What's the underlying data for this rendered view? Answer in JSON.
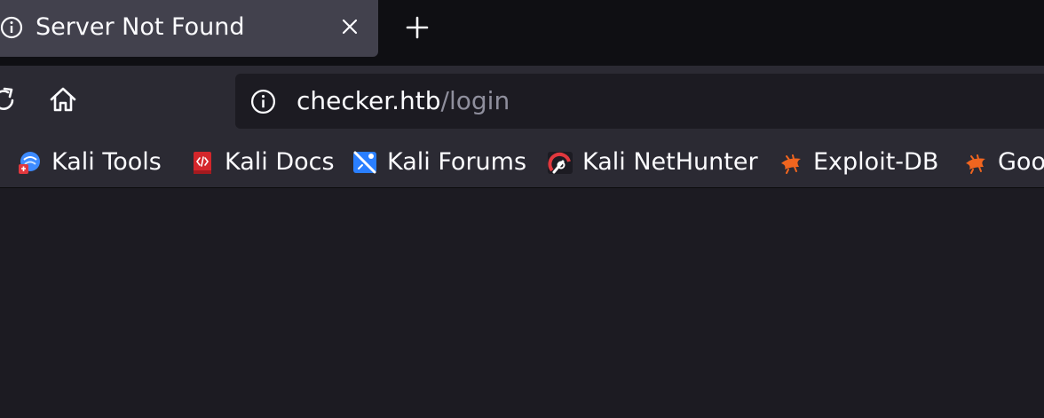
{
  "tab": {
    "title": "Server Not Found",
    "icon": "info-icon",
    "close_icon": "close-icon"
  },
  "toolbar": {
    "new_tab_icon": "plus-icon",
    "reload_icon": "reload-icon",
    "home_icon": "home-icon"
  },
  "urlbar": {
    "host": "checker.htb",
    "path": "/login",
    "icon": "info-icon"
  },
  "bookmarks": [
    {
      "label": "Kali Tools",
      "icon": "kali-tools-icon"
    },
    {
      "label": "Kali Docs",
      "icon": "kali-docs-icon"
    },
    {
      "label": "Kali Forums",
      "icon": "kali-forums-icon"
    },
    {
      "label": "Kali NetHunter",
      "icon": "kali-nethunter-icon"
    },
    {
      "label": "Exploit-DB",
      "icon": "exploit-db-icon"
    },
    {
      "label": "Goo",
      "icon": "exploit-db-icon"
    }
  ],
  "colors": {
    "tabbar_bg": "#0f0f13",
    "active_tab_bg": "#42414d",
    "toolbar_bg": "#2b2a33",
    "content_bg": "#1c1b22",
    "url_path": "#8f8f9d"
  }
}
